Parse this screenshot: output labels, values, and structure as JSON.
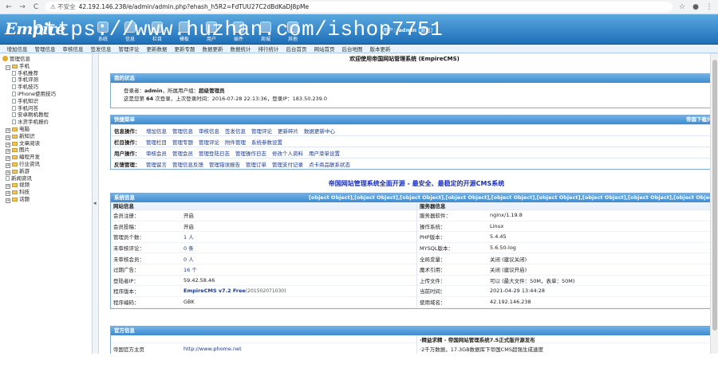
{
  "browser": {
    "back": "←",
    "forward": "→",
    "reload": "C",
    "security": "⚠ 不安全",
    "url": "42.192.146.238/e/admin/admin.php?ehash_h5R2=FdTUU27C2dBdKaDJ8pMe"
  },
  "header": {
    "logo_big": "Empire",
    "logo_small": "CMS",
    "watermark": "https://www.huzhan.com/ishop7751",
    "nav": [
      "系统",
      "信息",
      "栏目",
      "模板",
      "用户",
      "插件",
      "商城",
      "其他"
    ],
    "user_prefix": "用户：",
    "user": "admin",
    "logout": "[退出]"
  },
  "menubar": [
    "增加信息",
    "管理信息",
    "审核信息",
    "签发信息",
    "管理评论",
    "更新数据",
    "更新专题",
    "数据更新",
    "数据统计",
    "排行统计",
    "后台首页",
    "网站首页",
    "后台地图",
    "版本更新"
  ],
  "tree": [
    {
      "t": "管理信息",
      "k": "root",
      "i": 0
    },
    {
      "t": "手机",
      "k": "open",
      "i": 1
    },
    {
      "t": "手机推荐",
      "k": "page",
      "i": 3
    },
    {
      "t": "手机评测",
      "k": "page",
      "i": 3
    },
    {
      "t": "手机技巧",
      "k": "page",
      "i": 3
    },
    {
      "t": "iPhone使用技巧",
      "k": "page",
      "i": 3
    },
    {
      "t": "手机知识",
      "k": "page",
      "i": 3
    },
    {
      "t": "手机问答",
      "k": "page",
      "i": 3
    },
    {
      "t": "安卓刷机教程",
      "k": "page",
      "i": 3
    },
    {
      "t": "水货手机报价",
      "k": "page",
      "i": 3
    },
    {
      "t": "电脑",
      "k": "closed",
      "i": 1
    },
    {
      "t": "新知识",
      "k": "closed",
      "i": 1
    },
    {
      "t": "文章阅读",
      "k": "closed",
      "i": 1
    },
    {
      "t": "图片",
      "k": "closed",
      "i": 1
    },
    {
      "t": "编程开发",
      "k": "closed",
      "i": 1
    },
    {
      "t": "行业资讯",
      "k": "closed",
      "i": 1
    },
    {
      "t": "新游",
      "k": "closed",
      "i": 1
    },
    {
      "t": "新闻资讯",
      "k": "page",
      "i": 1
    },
    {
      "t": "视频",
      "k": "closed",
      "i": 1
    },
    {
      "t": "科技",
      "k": "closed",
      "i": 1
    },
    {
      "t": "话题",
      "k": "closed",
      "i": 1
    }
  ],
  "content": {
    "welcome": "欢迎使用帝国网站管理系统 (EmpireCMS)",
    "status": {
      "title": "我的状态",
      "line1_pre": "登录者：",
      "user": "admin",
      "line1_mid": "，所属用户组：",
      "group": "超级管理员",
      "line2_pre": "这是您第 ",
      "count": "64",
      "line2_mid": " 次登录，上次登录时间：",
      "time": "2016-07-28 22:13:36",
      "line2_ip": "，登录IP：",
      "ip": "183.50.239.0"
    },
    "quick": {
      "title": "快捷菜单",
      "right": "帝国下载共享",
      "rows": [
        {
          "label": "信息操作：",
          "items": [
            "增加信息",
            "管理信息",
            "审核信息",
            "签发信息",
            "管理评论",
            "更新碎片",
            "数据更新中心"
          ]
        },
        {
          "label": "栏目操作：",
          "items": [
            "管理栏目",
            "管理专题",
            "管理评论",
            "附件管理",
            "系统参数设置"
          ]
        },
        {
          "label": "用户操作：",
          "items": [
            "审核会员",
            "管理会员",
            "管理登陆日志",
            "管理操作日志",
            "修改个人资料",
            "用户菜单设置"
          ]
        },
        {
          "label": "反馈管理：",
          "items": [
            "管理留言",
            "管理信息反馈",
            "管理错误报告",
            "管理订单",
            "管理支付记录",
            "点卡商品联系状态"
          ]
        }
      ]
    },
    "slogan": "帝国网站管理系统全面开源 - 最安全、最稳定的开源CMS系统",
    "sysinfo": {
      "title": "系统信息",
      "right": [
        {
          "k": "服务器软件：",
          "v": "nginx/1.19.8"
        },
        {
          "k": "操作系统：",
          "v": "Linux"
        },
        {
          "k": "PHP版本：",
          "v": "5.4.45"
        },
        {
          "k": "MYSQL版本：",
          "v": "5.6.50-log"
        },
        {
          "k": "全局变量：",
          "v": "关闭 (建议关闭)"
        },
        {
          "k": "魔术引用：",
          "v": "关闭 (建议开启)"
        },
        {
          "k": "上传文件：",
          "v": "可以 (最大文件：50M，表单：50M)"
        },
        {
          "k": "当前时间：",
          "v": "2021-04-29 13:44:28"
        },
        {
          "k": "使用域名：",
          "v": "42.192.146.238"
        }
      ],
      "left_title": "网站信息",
      "right_title": "服务器信息",
      "left": [
        {
          "k": "会员注册：",
          "v": "开启"
        },
        {
          "k": "会员投稿：",
          "v": "开启"
        },
        {
          "k": "管理员个数：",
          "v": "1 人"
        },
        {
          "k": "未审核评论：",
          "v": "0 条"
        },
        {
          "k": "未审核会员：",
          "v": "0 人"
        },
        {
          "k": "过期广告：",
          "v": "16 个"
        },
        {
          "k": "登陆者IP：",
          "v": "59.42.58.46"
        },
        {
          "k": "程序版本：",
          "v": "EmpireCMS v7.2 Free",
          "v2": " (201502071030)"
        },
        {
          "k": "程序编码：",
          "v": "GBK"
        }
      ]
    },
    "official": {
      "title": "官方信息",
      "k": "帝国官方主页",
      "v": "http://www.phome.net",
      "news1": "·精益求精 - 帝国网站管理系统7.5正式版开源发布",
      "news2": "·2千万数据，17.3GB数据库下帝国CMS超强生成速度"
    }
  }
}
